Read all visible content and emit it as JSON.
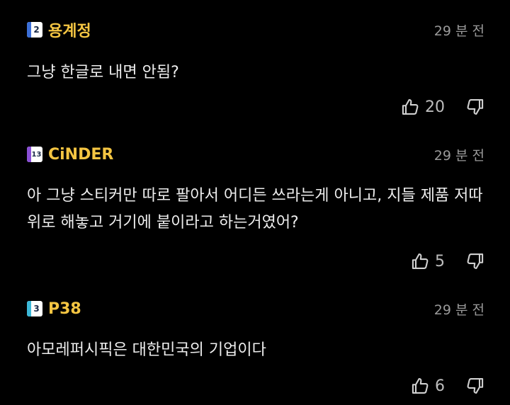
{
  "comments": [
    {
      "level": "2",
      "level_color": "#3b6fd8",
      "username": "용계정",
      "time": "29 분 전",
      "text": "그냥 한글로 내면 안됨?",
      "likes": "20"
    },
    {
      "level": "13",
      "level_color": "#8a4fd6",
      "username": "CiNDER",
      "time": "29 분 전",
      "text": "아 그냥 스티커만 따로 팔아서 어디든 쓰라는게 아니고, 지들 제품 저따위로 해놓고 거기에 붙이라고 하는거였어?",
      "likes": "5"
    },
    {
      "level": "3",
      "level_color": "#3bb8d8",
      "username": "P38",
      "time": "29 분 전",
      "text": "아모레퍼시픽은 대한민국의 기업이다",
      "likes": "6"
    }
  ],
  "colors": {
    "background": "#000000",
    "username": "#f4c542",
    "text": "#eeeeee",
    "meta": "#9a9a9a"
  },
  "icons": {
    "like": "thumbs-up-icon",
    "dislike": "thumbs-down-icon"
  }
}
